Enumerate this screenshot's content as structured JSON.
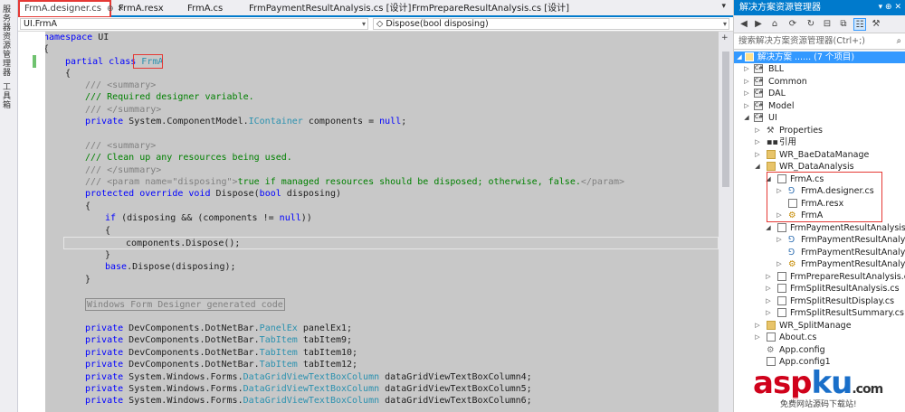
{
  "left_strip": {
    "item1": "服务器资源管理器",
    "item2": "工具箱"
  },
  "tabs": [
    {
      "label": "FrmA.designer.cs",
      "pin": "⊕",
      "close": "✕"
    },
    {
      "label": "FrmA.resx"
    },
    {
      "label": "FrmA.cs"
    },
    {
      "label": "FrmPaymentResultAnalysis.cs [设计]"
    },
    {
      "label": "FrmPrepareResultAnalysis.cs [设计]"
    }
  ],
  "tab_menu_icon": "▾",
  "nav": {
    "class_combo": "UI.FrmA",
    "member_combo": "Dispose(bool disposing)",
    "member_icon": "◇"
  },
  "code": {
    "l1a": "namespace",
    "l1b": " UI",
    "l2": "{",
    "l3a": "partial class ",
    "l3b": "FrmA",
    "l4": "{",
    "l5": "/// <summary>",
    "l6": "/// Required designer variable.",
    "l7": "/// </summary>",
    "l8a": "private ",
    "l8b": "System.ComponentModel.",
    "l8c": "IContainer",
    "l8d": " components = ",
    "l8e": "null",
    "l8f": ";",
    "l10": "/// <summary>",
    "l11": "/// Clean up any resources being used.",
    "l12": "/// </summary>",
    "l13a": "/// <param name=\"disposing\">",
    "l13b": "true if managed resources should be disposed; otherwise, false.",
    "l13c": "</param>",
    "l14a": "protected override void",
    "l14b": " Dispose(",
    "l14c": "bool",
    "l14d": " disposing)",
    "l15": "{",
    "l16a": "if",
    "l16b": " (disposing && (components != ",
    "l16c": "null",
    "l16d": "))",
    "l17": "{",
    "l18": "components.Dispose();",
    "l19": "}",
    "l20a": "base",
    "l20b": ".Dispose(disposing);",
    "l21": "}",
    "l23": "Windows Form Designer generated code",
    "l25a": "private ",
    "l25b": "DevComponents.DotNetBar.",
    "l25c": "PanelEx",
    "l25d": " panelEx1;",
    "l26a": "private ",
    "l26b": "DevComponents.DotNetBar.",
    "l26c": "TabItem",
    "l26d": " tabItem9;",
    "l27a": "private ",
    "l27b": "DevComponents.DotNetBar.",
    "l27c": "TabItem",
    "l27d": " tabItem10;",
    "l28a": "private ",
    "l28b": "DevComponents.DotNetBar.",
    "l28c": "TabItem",
    "l28d": " tabItem12;",
    "l29a": "private ",
    "l29b": "System.Windows.Forms.",
    "l29c": "DataGridViewTextBoxColumn",
    "l29d": " dataGridViewTextBoxColumn4;",
    "l30a": "private ",
    "l30b": "System.Windows.Forms.",
    "l30c": "DataGridViewTextBoxColumn",
    "l30d": " dataGridViewTextBoxColumn5;",
    "l31a": "private ",
    "l31b": "System.Windows.Forms.",
    "l31c": "DataGridViewTextBoxColumn",
    "l31d": " dataGridViewTextBoxColumn6;"
  },
  "solution_explorer": {
    "title": "解决方案资源管理器",
    "title_buttons": "▾ ⊕ ✕",
    "search_placeholder": "搜索解决方案资源管理器(Ctrl+;)",
    "search_icon": "⌕",
    "items": [
      {
        "label": "解决方案 ...... (7 个项目)"
      },
      {
        "label": "BLL"
      },
      {
        "label": "Common"
      },
      {
        "label": "DAL"
      },
      {
        "label": "Model"
      },
      {
        "label": "UI"
      },
      {
        "label": "Properties"
      },
      {
        "label": "引用"
      },
      {
        "label": "WR_BaeDataManage"
      },
      {
        "label": "WR_DataAnalysis"
      },
      {
        "label": "FrmA.cs"
      },
      {
        "label": "FrmA.designer.cs"
      },
      {
        "label": "FrmA.resx"
      },
      {
        "label": "FrmA"
      },
      {
        "label": "FrmPaymentResultAnalysis.cs"
      },
      {
        "label": "FrmPaymentResultAnalysis.cs"
      },
      {
        "label": "FrmPaymentResultAnalysis.r"
      },
      {
        "label": "FrmPaymentResultAnalysis"
      },
      {
        "label": "FrmPrepareResultAnalysis.cs"
      },
      {
        "label": "FrmSplitResultAnalysis.cs"
      },
      {
        "label": "FrmSplitResultDisplay.cs"
      },
      {
        "label": "FrmSplitResultSummary.cs"
      },
      {
        "label": "WR_SplitManage"
      },
      {
        "label": "About.cs"
      },
      {
        "label": "App.config"
      },
      {
        "label": "App.config1"
      }
    ]
  },
  "watermark": {
    "main": "asp",
    "accent": "ku",
    "suffix": ".com",
    "sub": "免费网站源码下载站!"
  }
}
